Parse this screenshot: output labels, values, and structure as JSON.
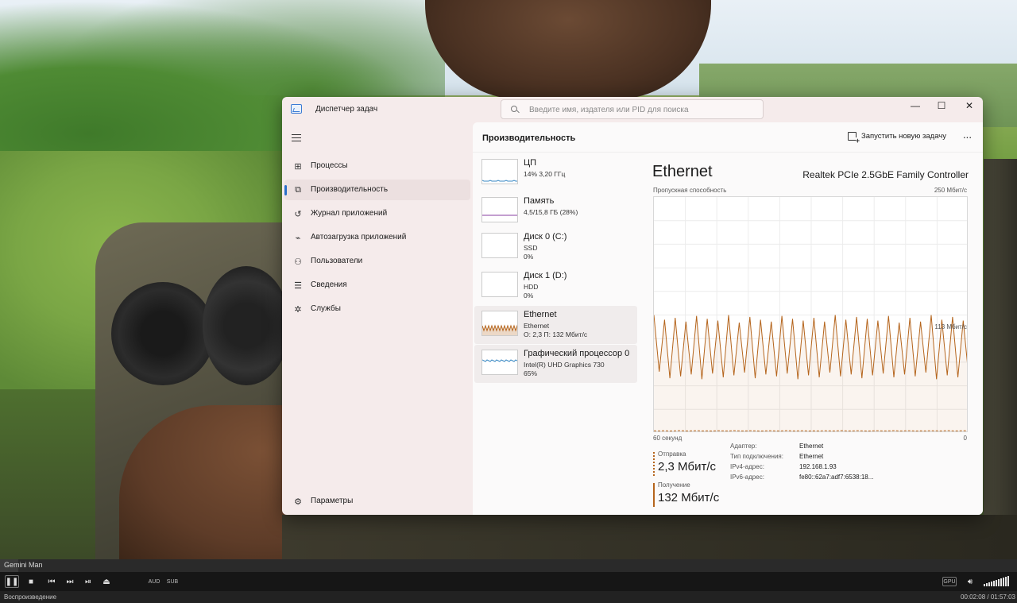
{
  "player": {
    "title": "Gemini Man",
    "progress": 0.0181,
    "controls": {
      "audio_label": "AUD",
      "sub_label": "SUB",
      "gpu_label": "GPU"
    },
    "status": {
      "state": "Воспроизведение",
      "time": "00:02:08 / 01:57:03"
    }
  },
  "taskmanager": {
    "title": "Диспетчер задач",
    "search_placeholder": "Введите имя, издателя или PID для поиска",
    "window_controls": {
      "minimize": "—",
      "maximize": "☐",
      "close": "✕"
    },
    "nav": {
      "items": [
        {
          "label": "Процессы",
          "icon": "processes-icon",
          "glyph": "⊞"
        },
        {
          "label": "Производительность",
          "icon": "performance-icon",
          "glyph": "⧉",
          "active": true
        },
        {
          "label": "Журнал приложений",
          "icon": "app-history-icon",
          "glyph": "↺"
        },
        {
          "label": "Автозагрузка приложений",
          "icon": "startup-apps-icon",
          "glyph": "⌁"
        },
        {
          "label": "Пользователи",
          "icon": "users-icon",
          "glyph": "⚇"
        },
        {
          "label": "Сведения",
          "icon": "details-icon",
          "glyph": "☰"
        },
        {
          "label": "Службы",
          "icon": "services-icon",
          "glyph": "✲"
        }
      ],
      "settings": {
        "label": "Параметры",
        "icon": "settings-icon",
        "glyph": "⚙"
      }
    },
    "header": {
      "title": "Производительность",
      "run_task": "Запустить новую задачу",
      "more": "···"
    },
    "devices": [
      {
        "name": "ЦП",
        "lines": [
          "14% 3,20 ГГц"
        ],
        "thumb_color": "#3b8ac4"
      },
      {
        "name": "Память",
        "lines": [
          "4,5/15,8 ГБ (28%)"
        ],
        "thumb_color": "#8a3fa0"
      },
      {
        "name": "Диск 0 (C:)",
        "lines": [
          "SSD",
          "0%"
        ],
        "thumb_color": "#4a9a3a"
      },
      {
        "name": "Диск 1 (D:)",
        "lines": [
          "HDD",
          "0%"
        ],
        "thumb_color": "#4a9a3a"
      },
      {
        "name": "Ethernet",
        "lines": [
          "Ethernet",
          "О: 2,3 П: 132 Мбит/с"
        ],
        "thumb_color": "#b5651d",
        "selected": true
      },
      {
        "name": "Графический процессор 0",
        "lines": [
          "Intel(R) UHD Graphics 730",
          "65%"
        ],
        "thumb_color": "#3b8ac4",
        "selected": true
      }
    ],
    "detail": {
      "title": "Ethernet",
      "model": "Realtek PCIe 2.5GbE Family Controller",
      "caption_left": "Пропускная способность",
      "caption_right": "250 Мбит/с",
      "marker_label": "113 Мбит/с",
      "axis_left": "60 секунд",
      "axis_right": "0",
      "send": {
        "label": "Отправка",
        "value": "2,3 Мбит/с",
        "color": "#b5651d"
      },
      "receive": {
        "label": "Получение",
        "value": "132 Мбит/с",
        "color": "#b5651d"
      },
      "properties": [
        {
          "key": "Адаптер:",
          "value": "Ethernet"
        },
        {
          "key": "Тип подключения:",
          "value": "Ethernet"
        },
        {
          "key": "IPv4-адрес:",
          "value": "192.168.1.93"
        },
        {
          "key": "IPv6-адрес:",
          "value": "fe80::62a7:adf7:6538:18..."
        }
      ]
    },
    "colors": {
      "accent": "#2a6fc9",
      "ethernet": "#b5651d",
      "window_bg": "#f5ebeb"
    }
  },
  "chart_data": {
    "type": "line",
    "title": "Ethernet",
    "xlabel": "60 секунд",
    "ylabel": "Пропускная способность",
    "ylim": [
      0,
      250
    ],
    "x_range": [
      60,
      0
    ],
    "series": [
      {
        "name": "Получение",
        "values": [
          125,
          65,
          120,
          58,
          122,
          60,
          118,
          62,
          124,
          57,
          121,
          63,
          119,
          59,
          125,
          61,
          117,
          64,
          123,
          58,
          120,
          62,
          118,
          60,
          124,
          63,
          121,
          57,
          119,
          61,
          122,
          59,
          118,
          64,
          125,
          60,
          120,
          62,
          123,
          58,
          121,
          61,
          119,
          63,
          124,
          59,
          117,
          62,
          122,
          60,
          118,
          64,
          125,
          57,
          120,
          61,
          123,
          59,
          119,
          62
        ]
      },
      {
        "name": "Отправка",
        "values": [
          2.3,
          2.2,
          2.4,
          2.1,
          2.3,
          2.5,
          2.2,
          2.3,
          2.4,
          2.2,
          2.3,
          2.1,
          2.4,
          2.3,
          2.2,
          2.5,
          2.3,
          2.2,
          2.4,
          2.3,
          2.1,
          2.3,
          2.4,
          2.2,
          2.3,
          2.5,
          2.2,
          2.3,
          2.4,
          2.1,
          2.3,
          2.2,
          2.4,
          2.3,
          2.2,
          2.5,
          2.3,
          2.2,
          2.4,
          2.3,
          2.1,
          2.3,
          2.4,
          2.2,
          2.3,
          2.5,
          2.2,
          2.3,
          2.4,
          2.1,
          2.3,
          2.2,
          2.4,
          2.3,
          2.2,
          2.5,
          2.3,
          2.2,
          2.4,
          2.3
        ]
      }
    ]
  }
}
